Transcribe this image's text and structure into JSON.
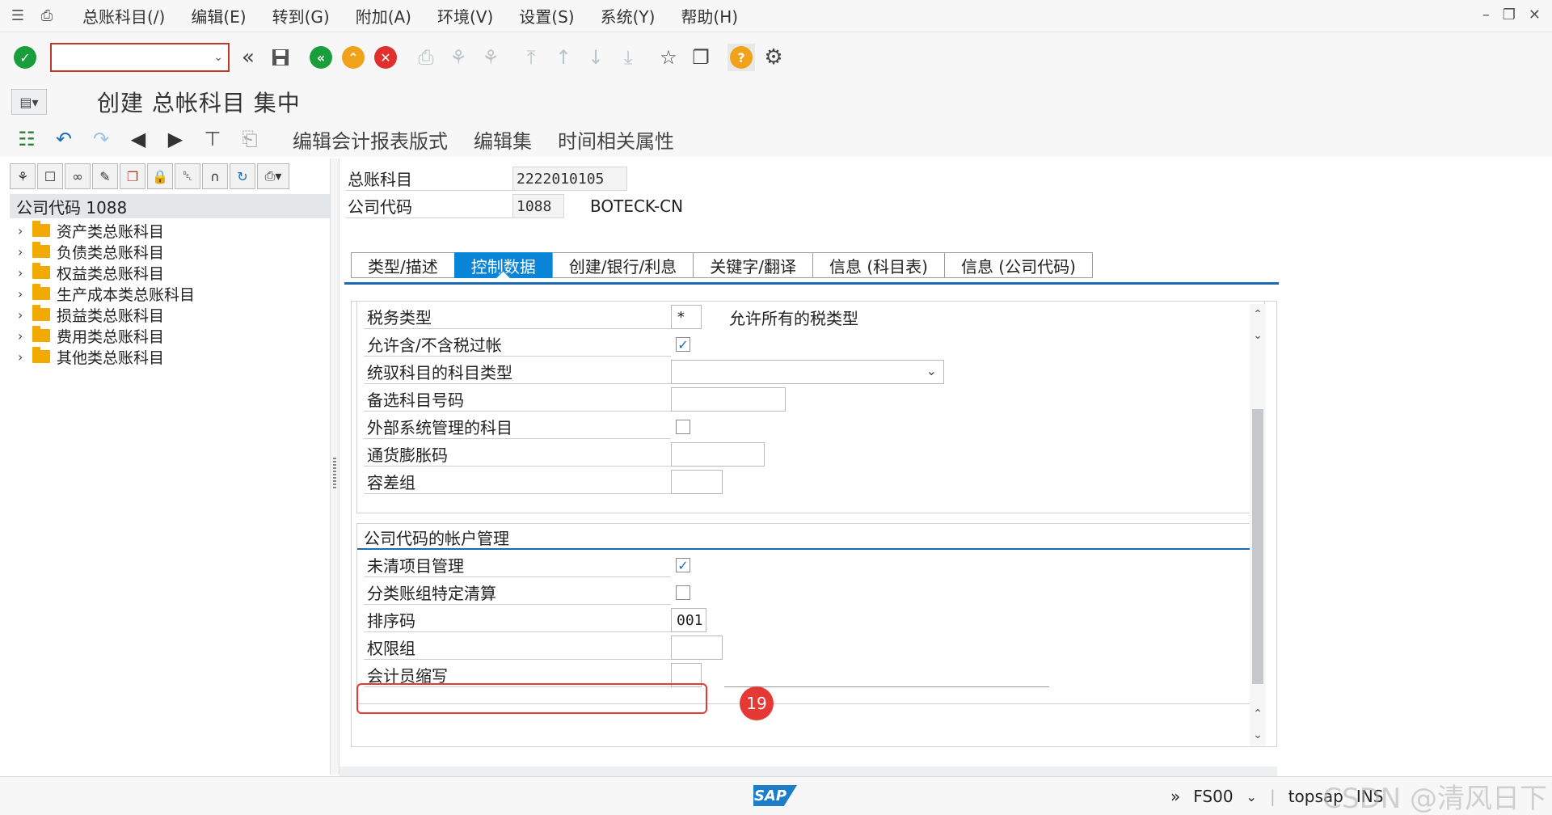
{
  "menubar": {
    "items": [
      "总账科目(/)",
      "编辑(E)",
      "转到(G)",
      "附加(A)",
      "环境(V)",
      "设置(S)",
      "系统(Y)",
      "帮助(H)"
    ]
  },
  "toolbar": {
    "command_field": ""
  },
  "title": "创建 总帐科目 集中",
  "app_toolbar": {
    "edit_layout": "编辑会计报表版式",
    "edit_set": "编辑集",
    "time_attr": "时间相关属性"
  },
  "tree": {
    "root": "公司代码 1088",
    "items": [
      "资产类总账科目",
      "负债类总账科目",
      "权益类总账科目",
      "生产成本类总账科目",
      "损益类总账科目",
      "费用类总账科目",
      "其他类总账科目"
    ]
  },
  "header": {
    "gl_label": "总账科目",
    "gl_value": "2222010105",
    "cc_label": "公司代码",
    "cc_value": "1088",
    "cc_name": "BOTECK-CN"
  },
  "tabs": [
    "类型/描述",
    "控制数据",
    "创建/银行/利息",
    "关键字/翻译",
    "信息 (科目表)",
    "信息 (公司代码)"
  ],
  "active_tab": "控制数据",
  "control": {
    "tax_category_label": "税务类型",
    "tax_category_value": "*",
    "tax_category_note": "允许所有的税类型",
    "post_without_tax_label": "允许含/不含税过帐",
    "recon_label": "统驭科目的科目类型",
    "alt_account_label": "备选科目号码",
    "ext_managed_label": "外部系统管理的科目",
    "inflation_label": "通货膨胀码",
    "tolerance_label": "容差组"
  },
  "account_mgmt": {
    "group_title": "公司代码的帐户管理",
    "open_item_label": "未清项目管理",
    "ledger_group_label": "分类账组特定清算",
    "sort_key_label": "排序码",
    "sort_key_value": "001",
    "auth_group_label": "权限组",
    "clerk_label": "会计员缩写"
  },
  "annotation": {
    "step": "19",
    "color": "#e53935"
  },
  "status": {
    "transaction": "FS00",
    "server": "topsap",
    "mode": "INS"
  },
  "watermark": "CSDN @清风日下"
}
